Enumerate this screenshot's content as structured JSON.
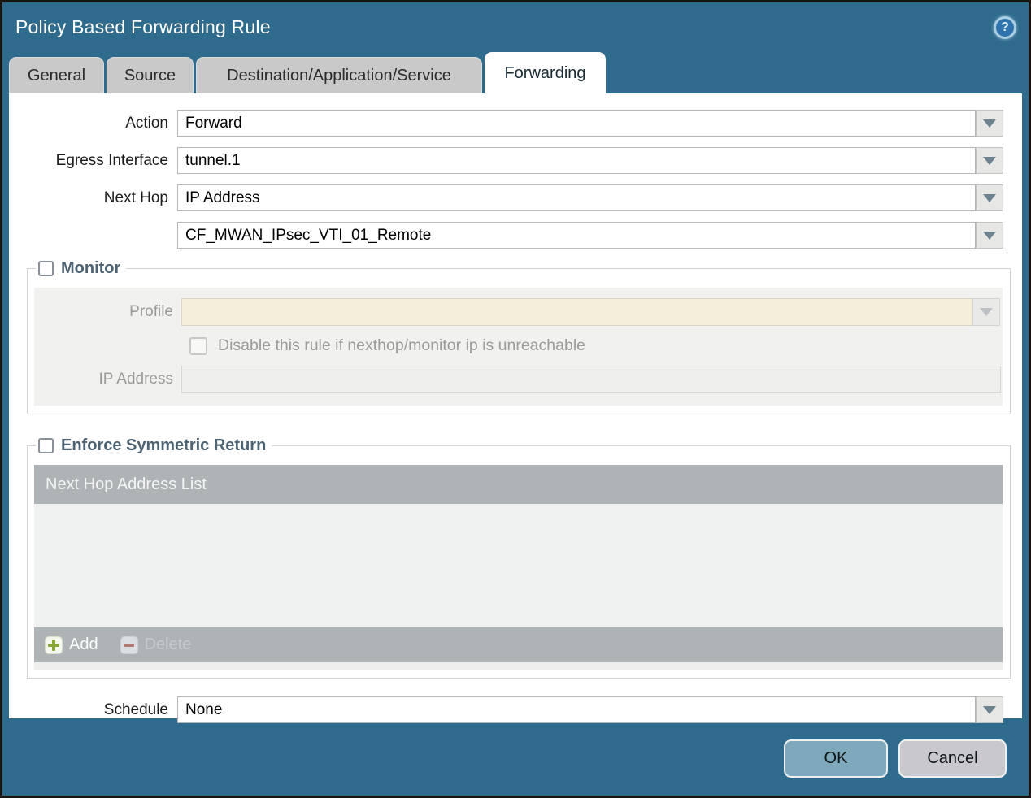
{
  "window": {
    "title": "Policy Based Forwarding Rule",
    "help_glyph": "?"
  },
  "tabs": [
    {
      "label": "General"
    },
    {
      "label": "Source"
    },
    {
      "label": "Destination/Application/Service"
    },
    {
      "label": "Forwarding"
    }
  ],
  "form": {
    "action_label": "Action",
    "action_value": "Forward",
    "egress_label": "Egress Interface",
    "egress_value": "tunnel.1",
    "next_hop_label": "Next Hop",
    "next_hop_value": "IP Address",
    "next_hop_address_value": "CF_MWAN_IPsec_VTI_01_Remote",
    "schedule_label": "Schedule",
    "schedule_value": "None"
  },
  "monitor": {
    "title": "Monitor",
    "checked": false,
    "profile_label": "Profile",
    "profile_value": "",
    "disable_checkbox_label": "Disable this rule if nexthop/monitor ip is unreachable",
    "disable_checked": false,
    "ip_label": "IP Address",
    "ip_value": ""
  },
  "symmetric": {
    "title": "Enforce Symmetric Return",
    "checked": false,
    "table_header": "Next Hop Address List",
    "rows": [],
    "add_label": "Add",
    "delete_label": "Delete"
  },
  "footer": {
    "ok_label": "OK",
    "cancel_label": "Cancel"
  },
  "colors": {
    "dialog_teal": "#2f6b8d",
    "active_tab_white": "#ffffff",
    "inactive_tab_gray": "#c9c9c9",
    "table_header_gray": "#aeb3b6",
    "disabled_field_beige": "#f5eedb",
    "ok_button_blue": "#7ea9bc",
    "cancel_button_gray": "#c9c9cd",
    "add_icon_green": "#87a636",
    "delete_icon_red": "#b07a72"
  }
}
